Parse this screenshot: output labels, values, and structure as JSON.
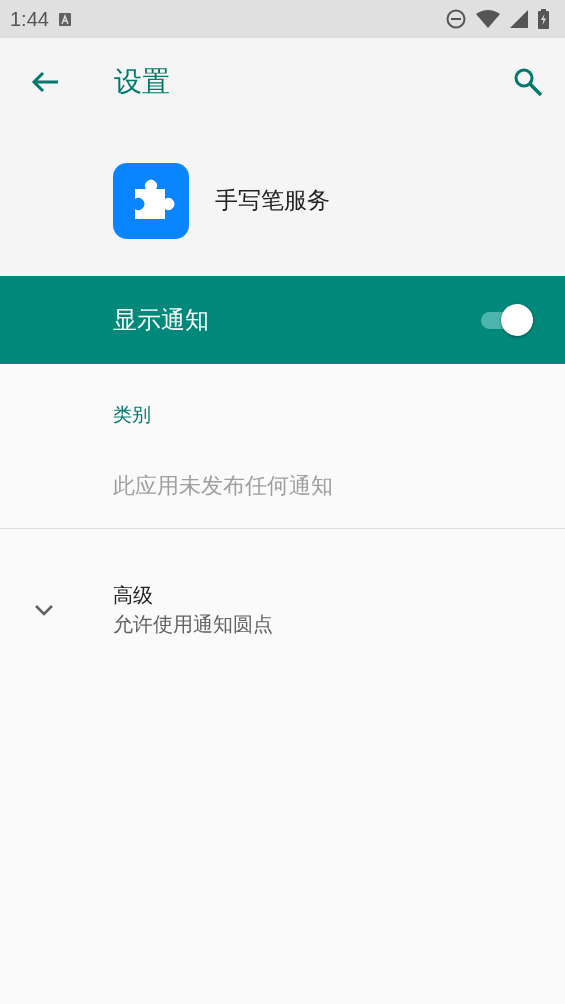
{
  "status_bar": {
    "time": "1:44"
  },
  "toolbar": {
    "title": "设置"
  },
  "app": {
    "name": "手写笔服务"
  },
  "master_switch": {
    "label": "显示通知",
    "on": true
  },
  "category": {
    "header": "类别",
    "empty_message": "此应用未发布任何通知"
  },
  "advanced": {
    "title": "高级",
    "summary": "允许使用通知圆点",
    "expanded": false
  }
}
